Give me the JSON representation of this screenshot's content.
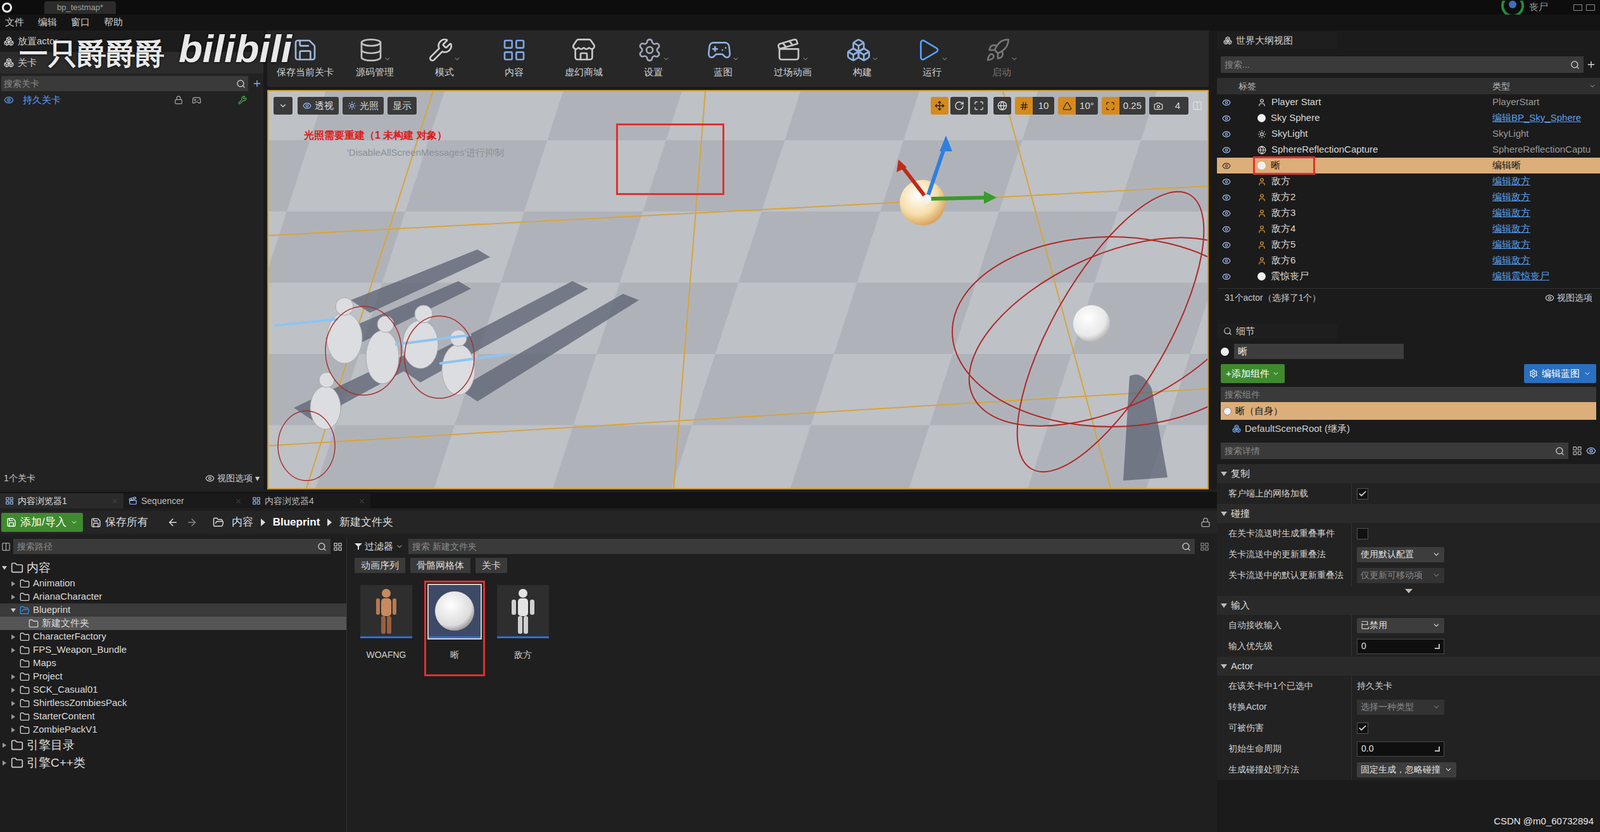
{
  "title_bar": {
    "tab": "bp_testmap*",
    "user": "丧尸"
  },
  "menu": [
    "文件",
    "编辑",
    "窗口",
    "帮助"
  ],
  "watermark": {
    "author": "一只爵爵爵",
    "site": "bilibili"
  },
  "csdn": "CSDN @m0_60732894",
  "left_panel": {
    "tabs": [
      {
        "label": "放置actor",
        "selected": false
      },
      {
        "label": "关卡",
        "selected": true
      }
    ],
    "search": "搜索关卡",
    "levels": [
      {
        "label": "持久关卡",
        "visible": true
      }
    ],
    "footer": "1个关卡",
    "view_options": "视图选项"
  },
  "toolbar": [
    {
      "label": "保存当前关卡",
      "dropdown": false,
      "disabled": false
    },
    {
      "label": "源码管理",
      "dropdown": true,
      "disabled": false
    },
    {
      "label": "模式",
      "dropdown": true,
      "disabled": false
    },
    {
      "label": "内容",
      "dropdown": false,
      "disabled": false
    },
    {
      "label": "虚幻商城",
      "dropdown": false,
      "disabled": false
    },
    {
      "label": "设置",
      "dropdown": true,
      "disabled": false
    },
    {
      "label": "蓝图",
      "dropdown": true,
      "disabled": false
    },
    {
      "label": "过场动画",
      "dropdown": true,
      "disabled": false
    },
    {
      "label": "构建",
      "dropdown": true,
      "disabled": false
    },
    {
      "label": "运行",
      "dropdown": true,
      "disabled": false
    },
    {
      "label": "启动",
      "dropdown": true,
      "disabled": true
    }
  ],
  "viewport": {
    "view_buttons": [
      "透视",
      "光照",
      "显示"
    ],
    "snaps": [
      {
        "value": "10",
        "active": true
      },
      {
        "value": "10°",
        "active": true
      },
      {
        "value": "0.25",
        "active": true
      },
      {
        "value": "4",
        "active": false
      }
    ],
    "warning": "光照需要重建（1 未构建 对象）",
    "hint": "'DisableAllScreenMessages'进行抑制",
    "selection_highlighted": true
  },
  "outliner": {
    "title": "世界大纲视图",
    "search": "搜索...",
    "columns": [
      "标签",
      "类型"
    ],
    "rows": [
      {
        "label": "Player Start",
        "type": "PlayerStart",
        "link": false,
        "selected": false,
        "highlighted": false,
        "kind": "player-start"
      },
      {
        "label": "Sky Sphere",
        "type": "编辑BP_Sky_Sphere",
        "link": true,
        "selected": false,
        "highlighted": false,
        "kind": "sphere"
      },
      {
        "label": "SkyLight",
        "type": "SkyLight",
        "link": false,
        "selected": false,
        "highlighted": false,
        "kind": "light"
      },
      {
        "label": "SphereReflectionCapture",
        "type": "SphereReflectionCaptu",
        "link": false,
        "selected": false,
        "highlighted": false,
        "kind": "capture"
      },
      {
        "label": "晰",
        "type": "编辑晰",
        "link": true,
        "selected": true,
        "highlighted": true,
        "kind": "sphere"
      },
      {
        "label": "敌方",
        "type": "编辑敌方",
        "link": true,
        "selected": false,
        "highlighted": false,
        "kind": "pawn"
      },
      {
        "label": "敌方2",
        "type": "编辑敌方",
        "link": true,
        "selected": false,
        "highlighted": false,
        "kind": "pawn"
      },
      {
        "label": "敌方3",
        "type": "编辑敌方",
        "link": true,
        "selected": false,
        "highlighted": false,
        "kind": "pawn"
      },
      {
        "label": "敌方4",
        "type": "编辑敌方",
        "link": true,
        "selected": false,
        "highlighted": false,
        "kind": "pawn"
      },
      {
        "label": "敌方5",
        "type": "编辑敌方",
        "link": true,
        "selected": false,
        "highlighted": false,
        "kind": "pawn"
      },
      {
        "label": "敌方6",
        "type": "编辑敌方",
        "link": true,
        "selected": false,
        "highlighted": false,
        "kind": "pawn"
      },
      {
        "label": "震惊丧尸",
        "type": "编辑震惊丧尸",
        "link": true,
        "selected": false,
        "highlighted": false,
        "kind": "sphere"
      }
    ],
    "footer": "31个actor（选择了1个）",
    "view_options": "视图选项"
  },
  "details": {
    "title": "细节",
    "name": "晰",
    "add_component": "+添加组件",
    "edit_blueprint": "编辑蓝图",
    "component_search": "搜索组件",
    "components": [
      {
        "label": "晰（自身）",
        "selected": true,
        "depth": 0
      },
      {
        "label": "DefaultSceneRoot (继承)",
        "selected": false,
        "depth": 1
      }
    ],
    "detail_search": "搜索详情",
    "sections": [
      {
        "title": "复制",
        "expanded": true,
        "advanced": false,
        "rows": [
          {
            "label": "客户端上的网络加载",
            "kind": "checkbox",
            "checked": true
          }
        ]
      },
      {
        "title": "碰撞",
        "expanded": true,
        "advanced": true,
        "rows": [
          {
            "label": "在关卡流送时生成重叠事件",
            "kind": "checkbox",
            "checked": false
          },
          {
            "label": "关卡流送中的更新重叠法",
            "kind": "dropdown",
            "value": "使用默认配置",
            "disabled": false
          },
          {
            "label": "关卡流送中的默认更新重叠法",
            "kind": "dropdown",
            "value": "仅更新可移动项",
            "disabled": true
          }
        ]
      },
      {
        "title": "输入",
        "expanded": true,
        "advanced": false,
        "rows": [
          {
            "label": "自动接收输入",
            "kind": "dropdown",
            "value": "已禁用",
            "disabled": false
          },
          {
            "label": "输入优先级",
            "kind": "number",
            "value": "0"
          }
        ]
      },
      {
        "title": "Actor",
        "expanded": true,
        "advanced": false,
        "rows": [
          {
            "label": "在该关卡中1个已选中",
            "kind": "text",
            "value": "持久关卡"
          },
          {
            "label": "转换Actor",
            "kind": "dropdown",
            "value": "选择一种类型",
            "disabled": true
          },
          {
            "label": "可被伤害",
            "kind": "checkbox",
            "checked": true
          },
          {
            "label": "初始生命周期",
            "kind": "number",
            "value": "0.0"
          },
          {
            "label": "生成碰撞处理方法",
            "kind": "dropdown",
            "value": "固定生成，忽略碰撞",
            "disabled": false
          }
        ]
      }
    ]
  },
  "content_browser": {
    "tabs": [
      {
        "label": "内容浏览器1",
        "selected": true
      },
      {
        "label": "Sequencer",
        "selected": false
      },
      {
        "label": "内容浏览器4",
        "selected": false
      }
    ],
    "add_import": "添加/导入",
    "save_all": "保存所有",
    "breadcrumb": [
      "内容",
      "Blueprint",
      "新建文件夹"
    ],
    "path_search": "搜索路径",
    "tree": [
      {
        "label": "内容",
        "depth": 0,
        "root": true,
        "expandable": true,
        "expanded": true,
        "selected": false,
        "current": false
      },
      {
        "label": "Animation",
        "depth": 1,
        "root": false,
        "expandable": true,
        "expanded": false,
        "selected": false,
        "current": false
      },
      {
        "label": "ArianaCharacter",
        "depth": 1,
        "root": false,
        "expandable": true,
        "expanded": false,
        "selected": false,
        "current": false
      },
      {
        "label": "Blueprint",
        "depth": 1,
        "root": false,
        "expandable": true,
        "expanded": true,
        "selected": false,
        "current": true
      },
      {
        "label": "新建文件夹",
        "depth": 2,
        "root": false,
        "expandable": false,
        "expanded": false,
        "selected": true,
        "current": false
      },
      {
        "label": "CharacterFactory",
        "depth": 1,
        "root": false,
        "expandable": true,
        "expanded": false,
        "selected": false,
        "current": false
      },
      {
        "label": "FPS_Weapon_Bundle",
        "depth": 1,
        "root": false,
        "expandable": true,
        "expanded": false,
        "selected": false,
        "current": false
      },
      {
        "label": "Maps",
        "depth": 1,
        "root": false,
        "expandable": false,
        "expanded": false,
        "selected": false,
        "current": false
      },
      {
        "label": "Project",
        "depth": 1,
        "root": false,
        "expandable": true,
        "expanded": false,
        "selected": false,
        "current": false
      },
      {
        "label": "SCK_Casual01",
        "depth": 1,
        "root": false,
        "expandable": true,
        "expanded": false,
        "selected": false,
        "current": false
      },
      {
        "label": "ShirtlessZombiesPack",
        "depth": 1,
        "root": false,
        "expandable": true,
        "expanded": false,
        "selected": false,
        "current": false
      },
      {
        "label": "StarterContent",
        "depth": 1,
        "root": false,
        "expandable": true,
        "expanded": false,
        "selected": false,
        "current": false
      },
      {
        "label": "ZombiePackV1",
        "depth": 1,
        "root": false,
        "expandable": true,
        "expanded": false,
        "selected": false,
        "current": false
      },
      {
        "label": "引擎目录",
        "depth": 0,
        "root": true,
        "expandable": true,
        "expanded": false,
        "selected": false,
        "current": false
      },
      {
        "label": "引擎C++类",
        "depth": 0,
        "root": true,
        "expandable": true,
        "expanded": false,
        "selected": false,
        "current": false
      }
    ],
    "filter": "过滤器",
    "asset_search": "搜索 新建文件夹",
    "chips": [
      "动画序列",
      "骨骼网格体",
      "关卡"
    ],
    "assets": [
      {
        "label": "WOAFNG",
        "kind": "character",
        "selected": false,
        "highlighted": false
      },
      {
        "label": "晰",
        "kind": "sphere",
        "selected": true,
        "highlighted": true
      },
      {
        "label": "敌方",
        "kind": "mannequin",
        "selected": false,
        "highlighted": false
      }
    ]
  }
}
